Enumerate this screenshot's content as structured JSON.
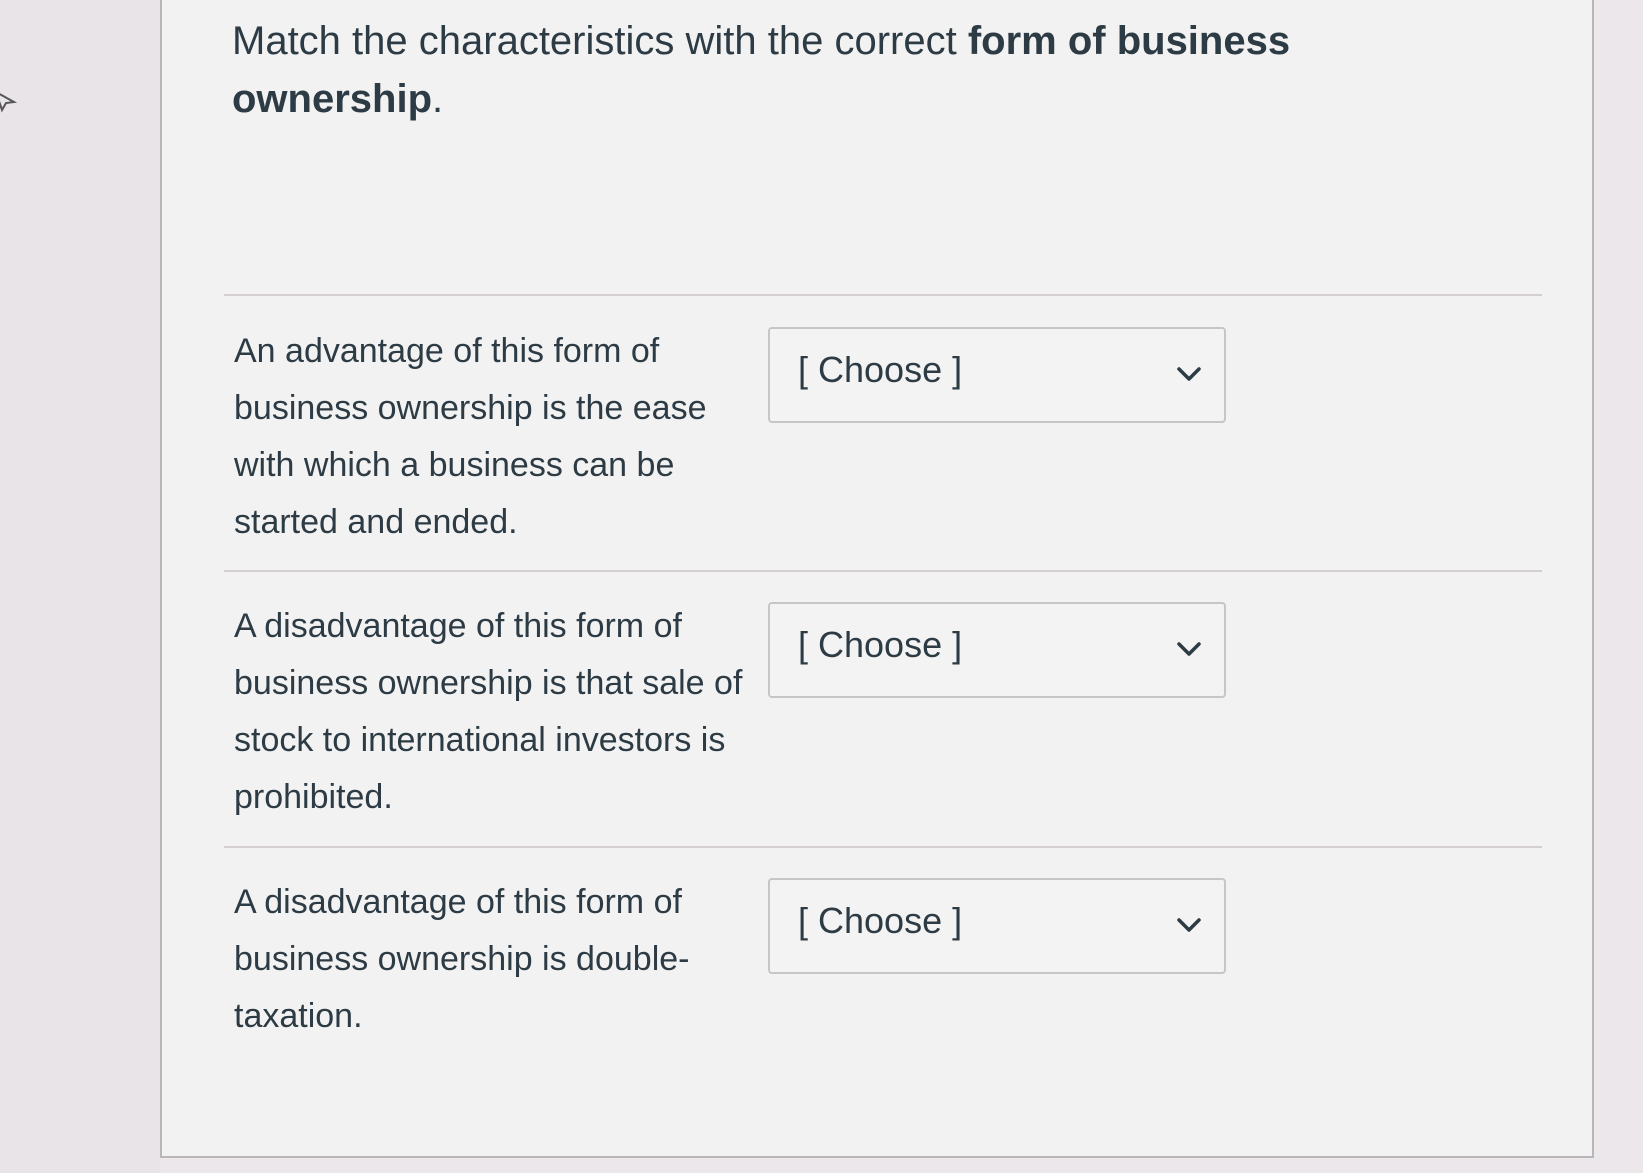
{
  "prompt": {
    "text_normal": "Match the characteristics with the correct ",
    "text_bold": "form of business ownership",
    "text_end": "."
  },
  "rows": [
    {
      "characteristic": "An advantage of this form of business ownership is the ease with which a business can be started and ended.",
      "select_value": "[ Choose ]"
    },
    {
      "characteristic": "A disadvantage of this form of business ownership is that sale of stock to international investors is prohibited.",
      "select_value": "[ Choose ]"
    },
    {
      "characteristic": "A disadvantage of this form of business ownership is double-taxation.",
      "select_value": "[ Choose ]"
    }
  ],
  "icons": {
    "dropdown": "chevron-down-icon",
    "cursor": "mouse-cursor-icon"
  }
}
